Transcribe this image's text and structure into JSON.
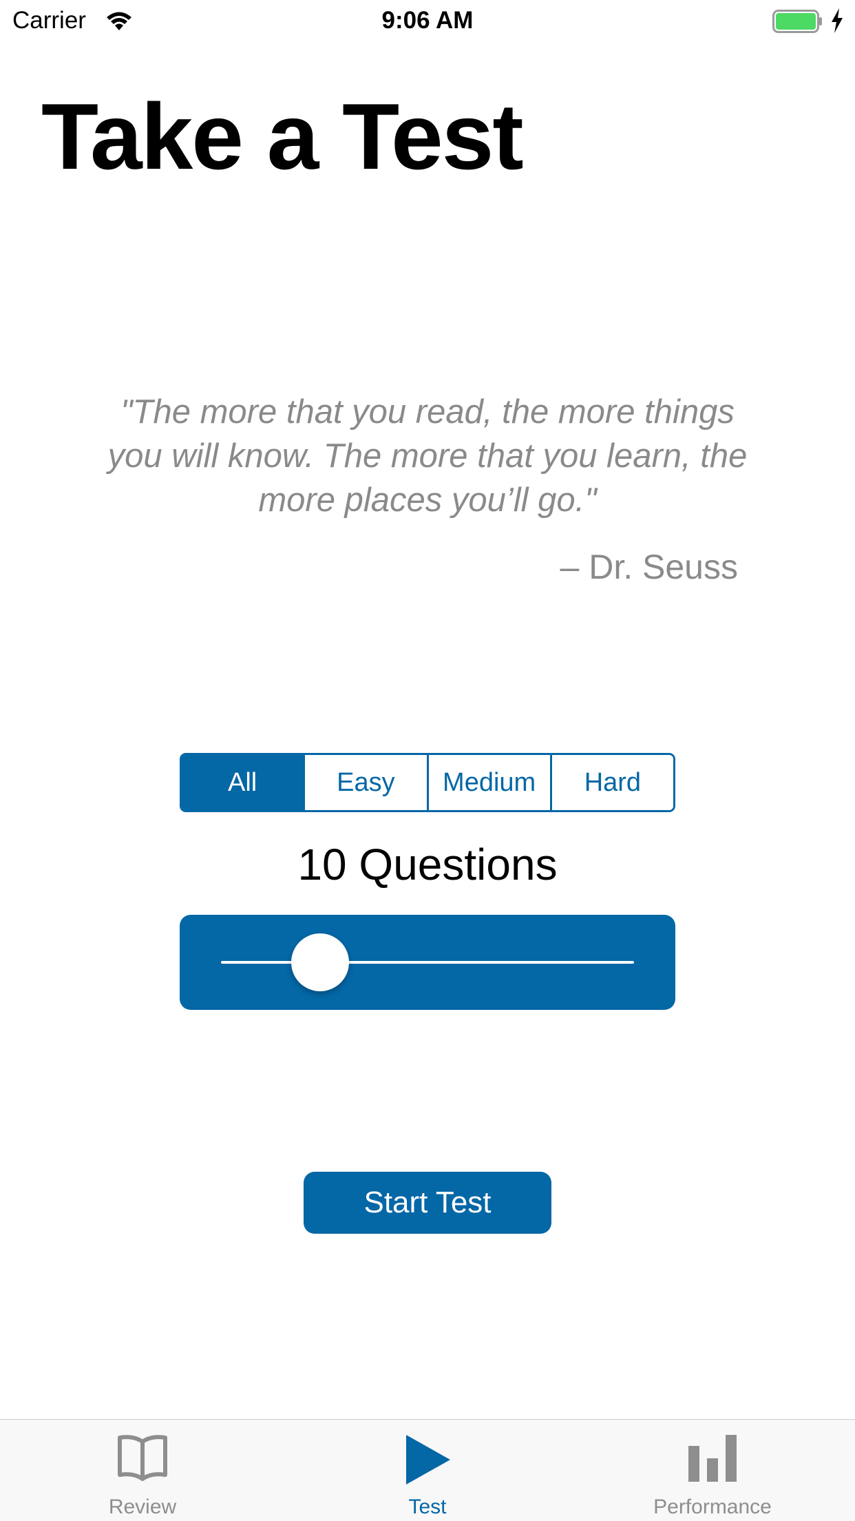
{
  "status_bar": {
    "carrier": "Carrier",
    "time": "9:06 AM",
    "battery_color": "#4cd964"
  },
  "page": {
    "title": "Take a Test"
  },
  "quote": {
    "text": "\"The more that you read, the more things you will know. The more that you learn, the more places you’ll go.\"",
    "author": "– Dr. Seuss"
  },
  "difficulty": {
    "options": [
      "All",
      "Easy",
      "Medium",
      "Hard"
    ],
    "selected": "All"
  },
  "questions": {
    "label": "10 Questions",
    "slider_fraction": 0.24
  },
  "start_button": {
    "label": "Start Test"
  },
  "tab_bar": {
    "tabs": [
      {
        "label": "Review",
        "icon": "book-icon"
      },
      {
        "label": "Test",
        "icon": "play-icon"
      },
      {
        "label": "Performance",
        "icon": "bar-chart-icon"
      }
    ],
    "active": "Test"
  },
  "colors": {
    "accent": "#0467a6",
    "inactive_tab": "#8e8e8e",
    "quote_text": "#8a8a8a"
  }
}
